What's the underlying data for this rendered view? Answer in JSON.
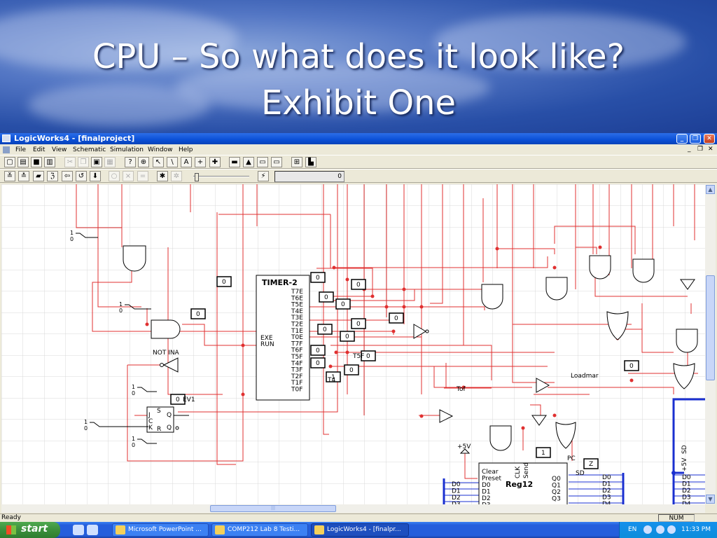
{
  "slide": {
    "title_line1": "CPU – So what does it look like?",
    "title_line2": "Exhibit One"
  },
  "window": {
    "title": "LogicWorks4 - [finalproject]",
    "buttons": [
      "_",
      "❐",
      "✕"
    ]
  },
  "menu": {
    "items": [
      "File",
      "Edit",
      "View",
      "Schematic",
      "Simulation",
      "Window",
      "Help"
    ],
    "mdi_controls": [
      "_",
      "❐",
      "✕"
    ]
  },
  "toolbar1": {
    "icons": [
      "new-icon",
      "open-icon",
      "save-icon",
      "print-icon",
      "cut-icon",
      "copy-icon",
      "paste-icon",
      "paste-special-icon",
      "help-icon",
      "zoom-icon",
      "pointer-icon",
      "wire-icon",
      "text-icon",
      "cross-icon",
      "add-icon",
      "chip-icon",
      "cell-icon",
      "image-icon",
      "screen-icon",
      "probe-icon",
      "timing-icon"
    ]
  },
  "toolbar2": {
    "icons": [
      "step-icon",
      "run-icon",
      "stop-icon",
      "reset-icon",
      "back-icon",
      "forward-icon",
      "record-icon",
      "sim-off-icon",
      "sim-x-icon",
      "sim-eq-icon",
      "walk-icon",
      "walk2-icon"
    ],
    "sim_value": "0"
  },
  "schematic": {
    "timer_label": "TIMER-2",
    "timer_inputs": [
      "EXE",
      "RUN"
    ],
    "timer_outputs": [
      "T7E",
      "T6E",
      "T5E",
      "T4E",
      "T3E",
      "T2E",
      "T1E",
      "T0E",
      "T7F",
      "T6F",
      "T5F",
      "T4F",
      "T3F",
      "T2F",
      "T1F",
      "T0F"
    ],
    "labels": {
      "not_ina": "NOT INA",
      "ev1": "EV1",
      "t5f": "T5F",
      "t4": "T4",
      "tof": "Tof",
      "loadmar": "Loadmar",
      "plus5v": "+5V",
      "pc": "PC",
      "sd": "SD"
    },
    "flipflop_pins": [
      "S",
      "J",
      "C",
      "K",
      "R",
      "Q",
      "Q"
    ],
    "switch_values": [
      "1",
      "0"
    ],
    "probes": [
      "0",
      "0",
      "0",
      "0",
      "0",
      "0",
      "0",
      "0",
      "0",
      "0",
      "0",
      "0",
      "0",
      "0",
      "1",
      "0",
      "1",
      "Z",
      "0"
    ],
    "reg12": {
      "name": "Reg12",
      "clk_label": "CLK",
      "send_label": "Send",
      "left_pins": [
        "Clear",
        "Preset",
        "D0",
        "D1",
        "D2",
        "D3"
      ],
      "right_pins": [
        "Q0",
        "Q1",
        "Q2",
        "Q3"
      ]
    },
    "bus_labels": [
      "D0",
      "D1",
      "D2",
      "D3",
      "D4"
    ],
    "bus_labels2": [
      "D0",
      "D1",
      "D2",
      "D3",
      "D4"
    ],
    "left_bus_labels": [
      "D0",
      "D1",
      "D2",
      "D3"
    ],
    "side_labels": [
      "+5V",
      "SD"
    ]
  },
  "status": {
    "text": "Ready",
    "num": "NUM"
  },
  "taskbar": {
    "start": "start",
    "tasks": [
      "Microsoft PowerPoint ...",
      "COMP212 Lab 8 Testi...",
      "LogicWorks4 - [finalpr..."
    ],
    "lang": "EN",
    "clock": "11:33 PM"
  },
  "colors": {
    "wire": "#e03030",
    "bus": "#1a2fd0",
    "grid": "#d8d8d8"
  }
}
